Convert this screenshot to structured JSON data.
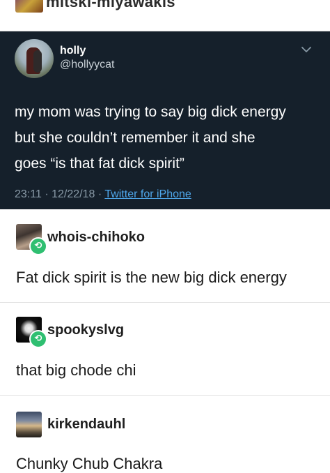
{
  "top_blog": {
    "name": "mitski-miyawakis"
  },
  "tweet": {
    "display_name": "holly",
    "handle": "@hollyycat",
    "text_lines": [
      "my mom was trying to say big dick energy",
      "but she couldn’t remember it and she",
      "goes “is that fat dick spirit”"
    ],
    "time": "23:11",
    "date": "12/22/18",
    "separator": "·",
    "source": "Twitter for iPhone",
    "colors": {
      "background": "#15202b",
      "link": "#4ea6ea",
      "meta": "#8899a6"
    }
  },
  "posts": [
    {
      "username": "whois-chihoko",
      "text": "Fat dick spirit is the new big dick energy",
      "reblog_icon": "reblog-icon"
    },
    {
      "username": "spookyslvg",
      "text": "that big chode chi",
      "reblog_icon": "reblog-icon"
    },
    {
      "username": "kirkendauhl",
      "text": "Chunky Chub Chakra"
    }
  ]
}
